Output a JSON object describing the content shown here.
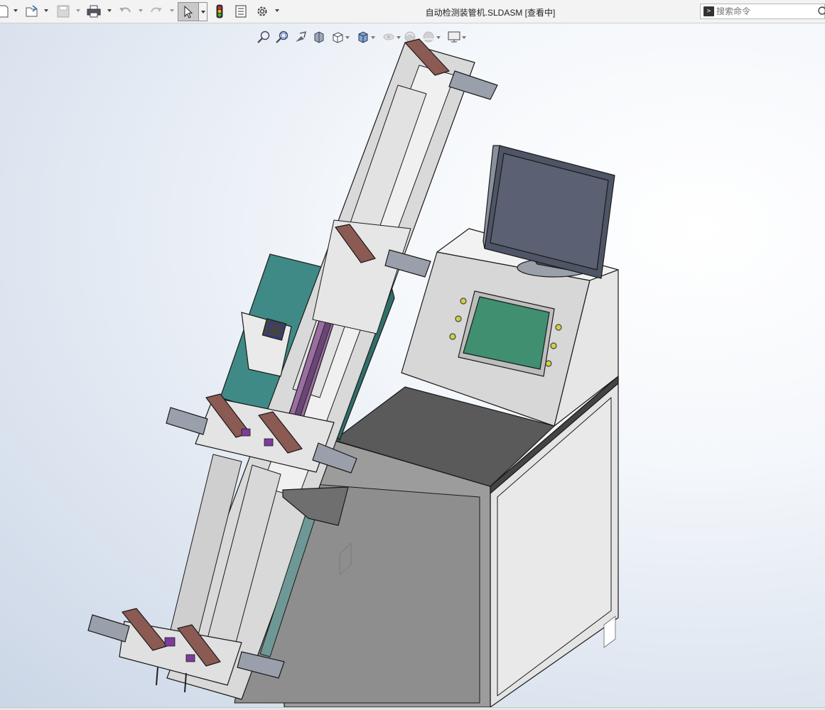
{
  "app": {
    "document_title": "自动检测装管机.SLDASM [查看中]",
    "search_placeholder": "搜索命令"
  },
  "toolbar": {
    "buttons": [
      {
        "name": "new-icon"
      },
      {
        "name": "open-icon"
      },
      {
        "name": "save-icon"
      },
      {
        "name": "print-icon"
      },
      {
        "name": "undo-icon"
      },
      {
        "name": "redo-icon"
      },
      {
        "name": "select-icon",
        "active": true
      },
      {
        "name": "rebuild-traffic-light-icon"
      },
      {
        "name": "file-properties-icon"
      },
      {
        "name": "options-gear-icon"
      }
    ]
  },
  "heads_up_toolbar": [
    "zoom-to-fit-icon",
    "zoom-to-area-icon",
    "previous-view-icon",
    "section-view-icon",
    "view-orientation-icon",
    "display-style-icon",
    "hide-show-items-icon",
    "edit-appearance-icon",
    "apply-scene-icon",
    "view-settings-icon"
  ],
  "colors": {
    "toolbar_bg": "#f3f3f3",
    "viewport_bg": "#e6ecf4",
    "panel_teal": "#3f8a86",
    "screen_green": "#3f8f70",
    "tabletop": "#5a5a5a",
    "cabinet_front": "#9c9c9c",
    "cabinet_side": "#e4e4e4",
    "cylinder_brown": "#8b5a52",
    "monitor": "#4e5566"
  }
}
